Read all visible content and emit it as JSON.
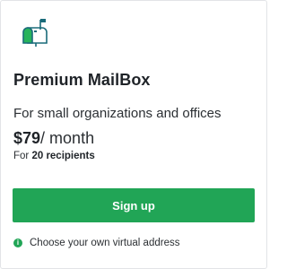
{
  "plan": {
    "icon": "mailbox-icon",
    "name": "Premium MailBox",
    "audience": "For small organizations and offices",
    "price_amount": "$79",
    "price_period": "/ month",
    "recipients_prefix": "For",
    "recipients_count": "20 recipients",
    "signup_label": "Sign up",
    "feature_icon": "info-icon",
    "feature_text": "Choose your own virtual address"
  },
  "colors": {
    "accent_green": "#21a556",
    "mailbox_teal": "#1a6b7a",
    "text_dark": "#1f2328"
  }
}
